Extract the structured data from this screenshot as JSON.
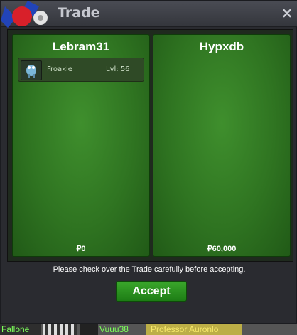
{
  "window": {
    "title": "Trade",
    "close_glyph": "×"
  },
  "trade": {
    "left": {
      "trainer": "Lebram31",
      "money": "₽0",
      "pokemon": [
        {
          "name": "Froakie",
          "level": "Lvl: 56",
          "icon": "froakie-sprite-icon"
        }
      ]
    },
    "right": {
      "trainer": "Hypxdb",
      "money": "₽60,000",
      "pokemon": []
    }
  },
  "notice": "Please check over the Trade carefully before accepting.",
  "accept_label": "Accept",
  "bottom_players": [
    "Fallone",
    "Vuuu38",
    "Professor Auronlo"
  ],
  "colors": {
    "panel_green": "#2f7421",
    "accept_green": "#2a9420",
    "window_bg": "#2a2b30"
  }
}
